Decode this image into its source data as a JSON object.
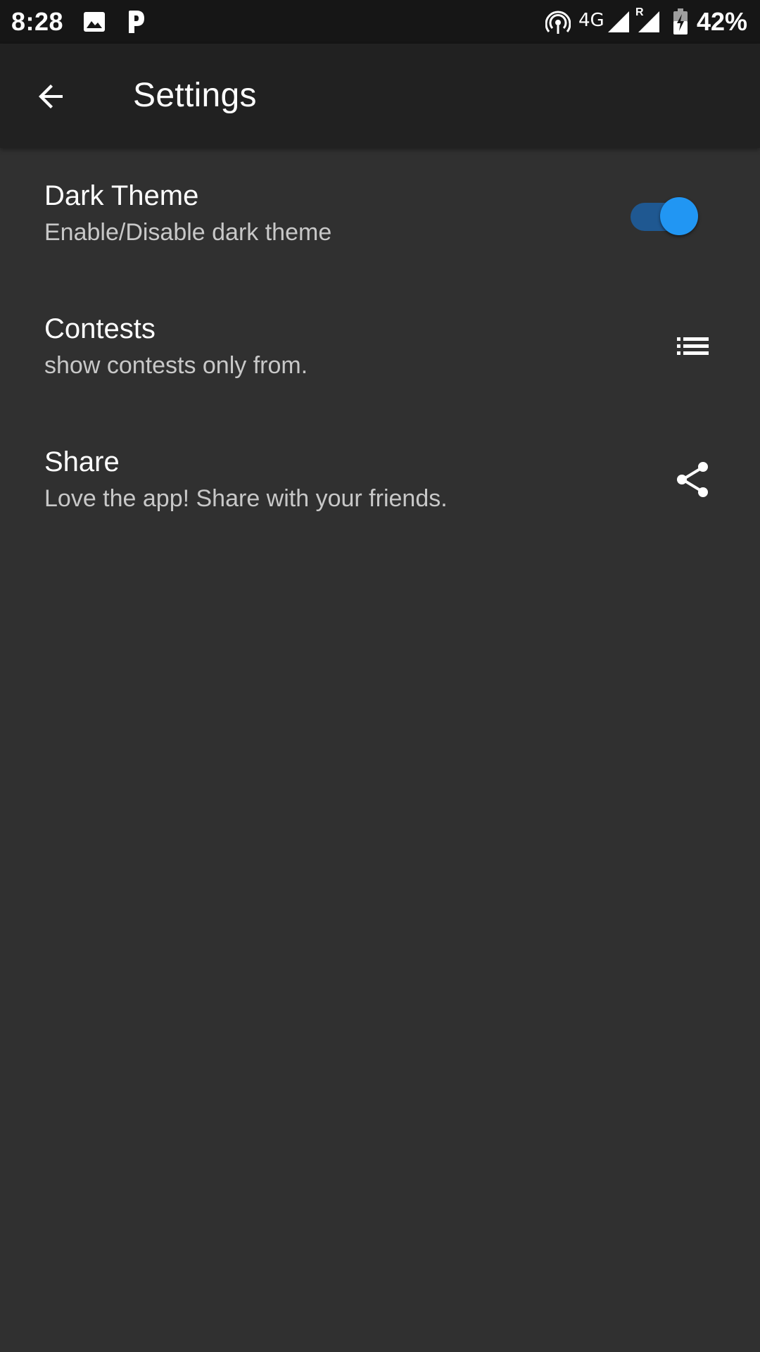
{
  "status_bar": {
    "time": "8:28",
    "network": "4G",
    "roaming": "R",
    "battery": "42%",
    "icons": [
      "image-icon",
      "p-app-icon",
      "hotspot-icon",
      "signal-icon",
      "roaming-signal-icon",
      "battery-charging-icon"
    ]
  },
  "app_bar": {
    "title": "Settings",
    "back_icon": "arrow-back-icon"
  },
  "settings": [
    {
      "title": "Dark Theme",
      "summary": "Enable/Disable dark theme",
      "control": "toggle",
      "checked": true
    },
    {
      "title": "Contests",
      "summary": "show contests only from.",
      "control": "list-icon"
    },
    {
      "title": "Share",
      "summary": "Love the app! Share with your friends.",
      "control": "share-icon"
    }
  ],
  "colors": {
    "background": "#303030",
    "app_bar": "#212121",
    "status_bar": "#161616",
    "accent": "#2196f3",
    "toggle_track": "#1f5891",
    "title_text": "#ffffff",
    "summary_text": "#c8c8c8"
  }
}
